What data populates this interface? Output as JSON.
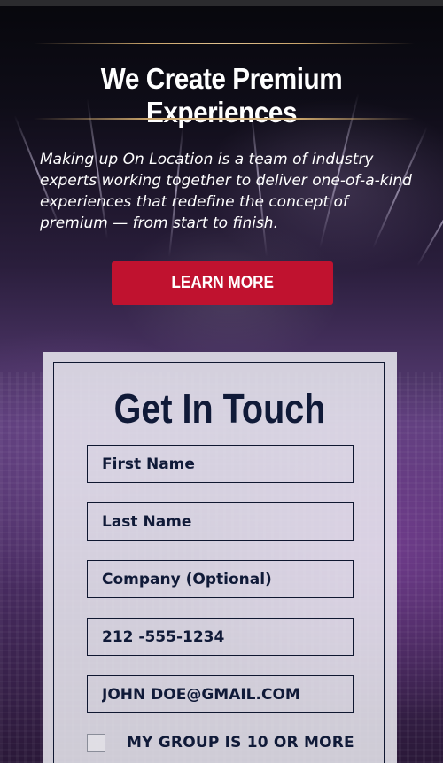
{
  "hero": {
    "title": "We Create Premium Experiences",
    "description": "Making up On Location is a team of industry experts working together to deliver one-of-a-kind experiences that redefine the concept of premium — from start to finish.",
    "button_label": "LEARN MORE"
  },
  "contact_form": {
    "title": "Get In Touch",
    "fields": {
      "first_name": {
        "placeholder": "First Name"
      },
      "last_name": {
        "placeholder": "Last Name"
      },
      "company": {
        "placeholder": "Company (Optional)"
      },
      "phone": {
        "placeholder": "212 -555-1234"
      },
      "email": {
        "placeholder": "JOHN DOE@GMAIL.COM"
      }
    },
    "group_checkbox_label": "MY GROUP IS 10 OR MORE"
  },
  "colors": {
    "accent_button": "#c0122f",
    "form_text": "#101a38",
    "rule_gold": "#c9a46b"
  }
}
